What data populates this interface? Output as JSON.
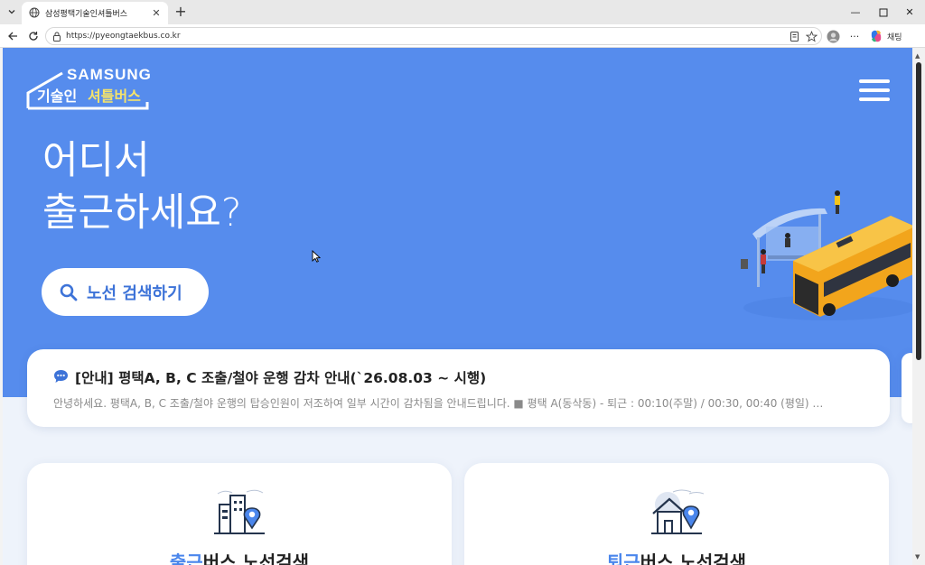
{
  "browser": {
    "tab_title": "삼성평택기술인셔틀버스",
    "url": "https://pyeongtaekbus.co.kr",
    "copilot_label": "채팅",
    "icons": [
      "tab-list-icon",
      "globe-icon",
      "close-icon",
      "new-tab-icon",
      "minimize-icon",
      "maximize-icon",
      "window-close-icon",
      "back-icon",
      "refresh-icon",
      "lock-icon",
      "reader-icon",
      "star-icon",
      "profile-icon",
      "more-icon",
      "copilot-icon"
    ]
  },
  "header": {
    "logo_top": "SAMSUNG",
    "logo_part1": "기술인",
    "logo_part2": "셔틀버스",
    "accent_color": "#568ced",
    "logo_highlight_color": "#f5e36a"
  },
  "hero": {
    "line1": "어디서",
    "line2": "출근하세요?",
    "search_button": "노선 검색하기"
  },
  "notice": {
    "title": "[안내] 평택A, B, C 조출/철야 운행 감차 안내(`26.08.03 ~ 시행)",
    "body": "안녕하세요. 평택A, B, C 조출/철야 운행의 탑승인원이 저조하여 일부 시간이 감차됨을 안내드립니다. ■ 평택 A(동삭동) - 퇴근 : 00:10(주말) / 00:30, 00:40 (평일) …"
  },
  "cards": [
    {
      "highlight": "출근",
      "rest": "버스 노선검색"
    },
    {
      "highlight": "퇴근",
      "rest": "버스 노선검색"
    }
  ]
}
